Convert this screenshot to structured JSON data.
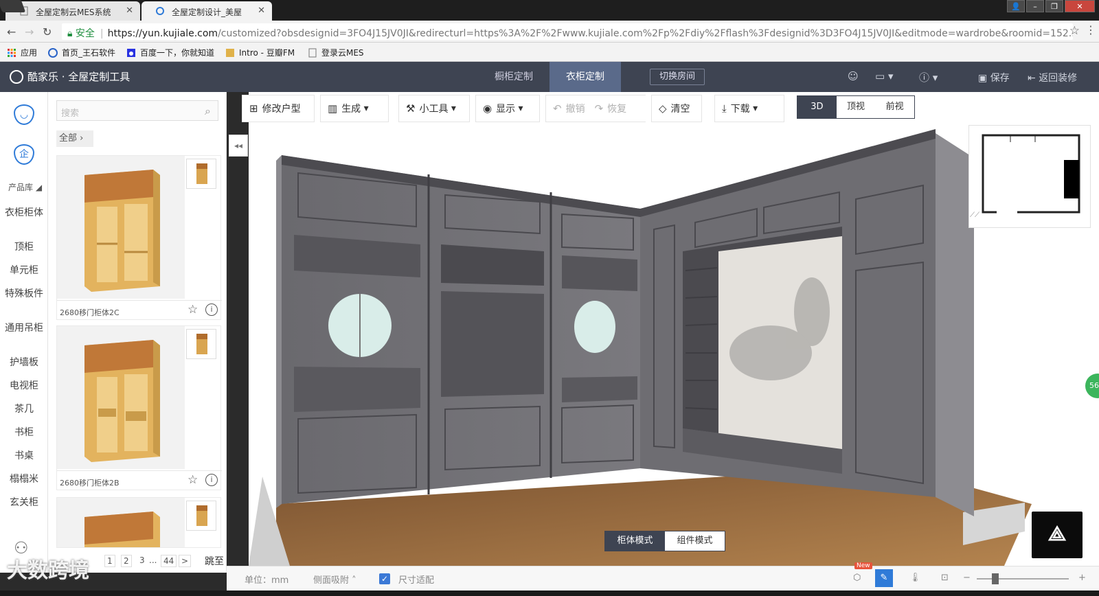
{
  "browser": {
    "tabs": [
      {
        "title": "全屋定制云MES系统"
      },
      {
        "title": "全屋定制设计_美屋"
      }
    ],
    "url": {
      "secure_label": "安全",
      "host": "https://yun.kujiale.com",
      "path": "/customized?obsdesignid=3FO4J15JV0JI&redirecturl=https%3A%2F%2Fwww.kujiale.com%2Fp%2Fdiy%2Fflash%3Fdesignid%3D3FO4J15JV0JI&editmode=wardrobe&roomid=152..."
    },
    "bookmarks": [
      {
        "label": "应用",
        "icon": "apps-grid-icon"
      },
      {
        "label": "首页_王石软件",
        "icon": "site-icon"
      },
      {
        "label": "百度一下，你就知道",
        "icon": "baidu-paw-icon"
      },
      {
        "label": "Intro - 豆瓣FM",
        "icon": "douban-icon"
      },
      {
        "label": "登录云MES",
        "icon": "page-icon"
      }
    ]
  },
  "app": {
    "brand": "酷家乐 · 全屋定制工具",
    "header_tabs": [
      {
        "label": "橱柜定制",
        "active": false
      },
      {
        "label": "衣柜定制",
        "active": true
      }
    ],
    "switch_room": "切换房间",
    "save": "保存",
    "return": "返回装修"
  },
  "rail": {
    "label": "产品库",
    "items": [
      "衣柜柜体",
      "顶柜",
      "单元柜",
      "特殊板件",
      "通用吊柜",
      "护墙板",
      "电视柜",
      "茶几",
      "书柜",
      "书桌",
      "榻榻米",
      "玄关柜"
    ]
  },
  "products": {
    "search_placeholder": "搜索",
    "filter": "全部",
    "cards": [
      {
        "name": "2680移门柜体2C"
      },
      {
        "name": "2680移门柜体2B"
      }
    ],
    "pager": {
      "pages": [
        "1",
        "2",
        "3",
        "...",
        "44"
      ],
      "next": ">",
      "jump": "跳至"
    }
  },
  "toolbar": {
    "modify_layout": "修改户型",
    "generate": "生成",
    "tools": "小工具",
    "display": "显示",
    "undo": "撤销",
    "redo": "恢复",
    "clear": "清空",
    "download": "下载"
  },
  "views": [
    {
      "label": "3D",
      "active": true
    },
    {
      "label": "顶视",
      "active": false
    },
    {
      "label": "前视",
      "active": false
    }
  ],
  "modes": [
    {
      "label": "柜体模式",
      "active": true
    },
    {
      "label": "组件模式",
      "active": false
    }
  ],
  "status": {
    "unit": "单位：mm",
    "side_snap": "侧面吸附",
    "fit_size": "尺寸适配",
    "new_tag": "New"
  },
  "badge_count": "56",
  "watermark": "大数跨境",
  "colors": {
    "header_bg": "#3e4452",
    "accent": "#2f7bd8",
    "cabinet_gray": "#6e6d72",
    "floor_wood": "#9a6b3d"
  }
}
